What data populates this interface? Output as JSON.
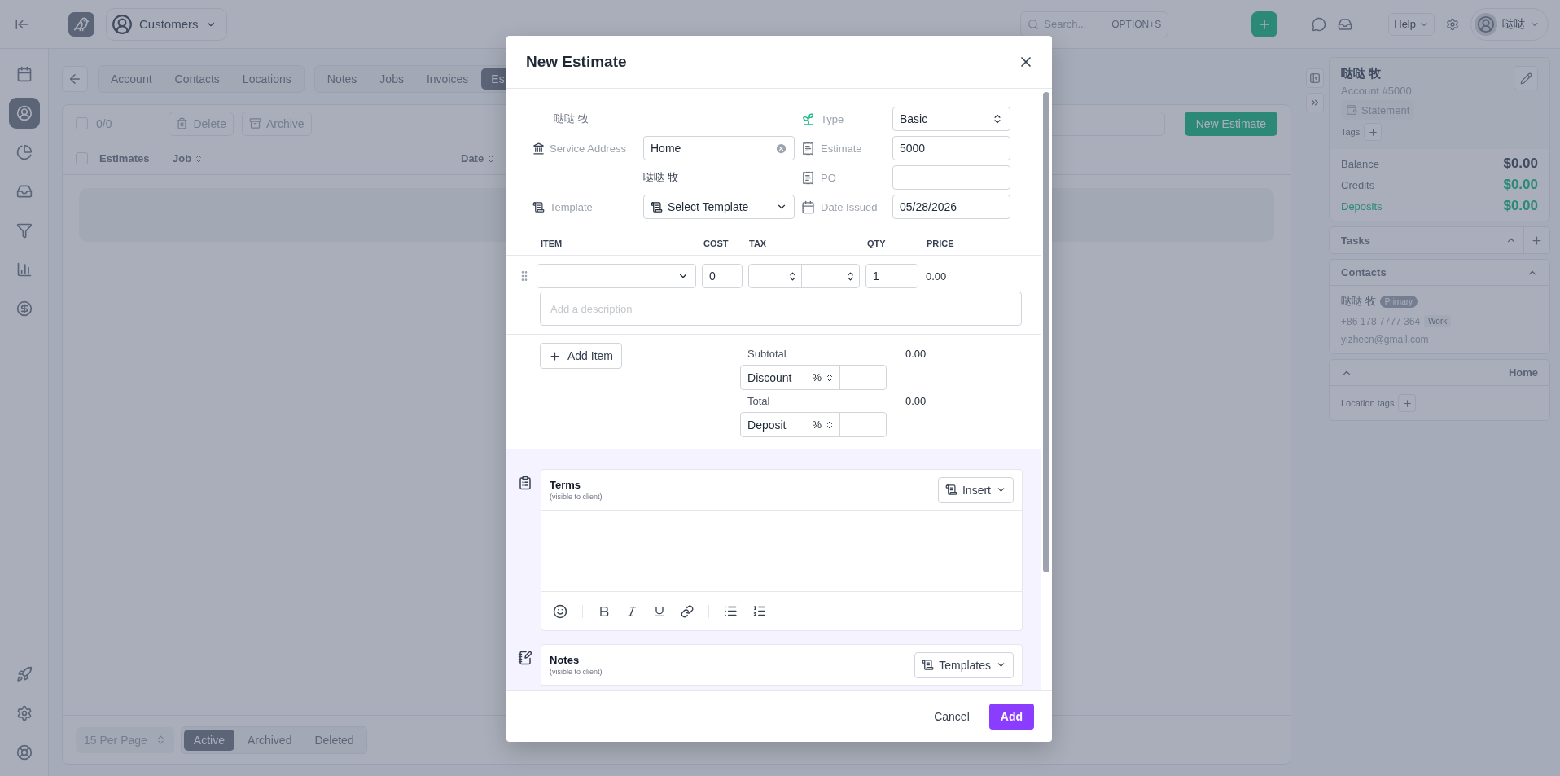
{
  "topbar": {
    "module": "Customers",
    "search": {
      "placeholder": "Search...",
      "shortcut": "OPTION+S"
    },
    "help": "Help",
    "user": "哒哒"
  },
  "sidebar": {
    "items": [
      {
        "selected": false
      },
      {
        "selected": true
      },
      {
        "selected": false
      },
      {
        "selected": false
      },
      {
        "selected": false
      },
      {
        "selected": false
      },
      {
        "selected": false
      }
    ]
  },
  "tab_groups": [
    [
      {
        "label": "Account",
        "selected": false
      },
      {
        "label": "Contacts",
        "selected": false
      },
      {
        "label": "Locations",
        "selected": false
      }
    ],
    [
      {
        "label": "Notes",
        "selected": false
      },
      {
        "label": "Jobs",
        "selected": false
      },
      {
        "label": "Invoices",
        "selected": false
      },
      {
        "label": "Es",
        "selected": true
      }
    ]
  ],
  "list": {
    "bar_checked": false,
    "header_checked": false,
    "count": "0/0",
    "actions": [
      "Delete",
      "Archive"
    ],
    "new_button": "New Estimate",
    "columns": [
      "Estimates",
      "Job",
      "Date"
    ],
    "per_page": "15 Per Page",
    "filters": [
      {
        "label": "Active",
        "selected": true
      },
      {
        "label": "Archived",
        "selected": false
      },
      {
        "label": "Deleted",
        "selected": false
      }
    ]
  },
  "customer": {
    "name": "哒哒 牧",
    "account": "Account #5000",
    "statement": "Statement",
    "tags_label": "Tags",
    "balances": [
      {
        "label": "Balance",
        "value": "$0.00",
        "color": "#414b5f",
        "highlighted": false
      },
      {
        "label": "Credits",
        "value": "$0.00",
        "color": "#2c8978",
        "highlighted": false
      },
      {
        "label": "Deposits",
        "value": "$0.00",
        "color": "#2c8978",
        "highlighted": true
      }
    ],
    "tasks": {
      "title": "Tasks",
      "expanded": false
    },
    "contacts": {
      "title": "Contacts",
      "expanded": true,
      "name": "哒哒 牧",
      "badge": "Primary",
      "phone": "+86 178 7777 364",
      "phone_type": "Work",
      "email": "yizhecn@gmail.com"
    },
    "location": {
      "title": "Home",
      "expanded": true,
      "tags_label": "Location tags"
    }
  },
  "modal": {
    "title": "New Estimate",
    "client": "哒哒 牧",
    "service_address": {
      "label": "Service Address",
      "value": "Home"
    },
    "template": {
      "label": "Template",
      "caption": "哒哒 牧",
      "value": "Select Template"
    },
    "fields": [
      {
        "kind": "select",
        "label": "Type",
        "value": "Basic"
      },
      {
        "kind": "input",
        "label": "Estimate",
        "value": "5000"
      },
      {
        "kind": "input",
        "label": "PO"
      },
      {
        "kind": "input",
        "label": "Date Issued",
        "value": "05/28/2026"
      }
    ],
    "columns": [
      "ITEM",
      "COST",
      "TAX",
      "QTY",
      "PRICE"
    ],
    "line": {
      "cost": "0",
      "qty": "1",
      "price": "0.00",
      "description_placeholder": "Add a description"
    },
    "add_item": "Add Item",
    "totals": [
      {
        "kind": "sum",
        "label": "Subtotal",
        "value": "0.00"
      },
      {
        "kind": "adjust",
        "label": "Discount",
        "unit": "%"
      },
      {
        "kind": "sum",
        "label": "Total",
        "value": "0.00"
      },
      {
        "kind": "adjust",
        "label": "Deposit",
        "unit": "%"
      }
    ],
    "sections": [
      {
        "title": "Terms",
        "note": "(visible to client)",
        "button": "Insert"
      },
      {
        "title": "Notes",
        "note": "(visible to client)",
        "button": "Templates"
      }
    ],
    "cancel": "Cancel",
    "submit": "Add"
  }
}
